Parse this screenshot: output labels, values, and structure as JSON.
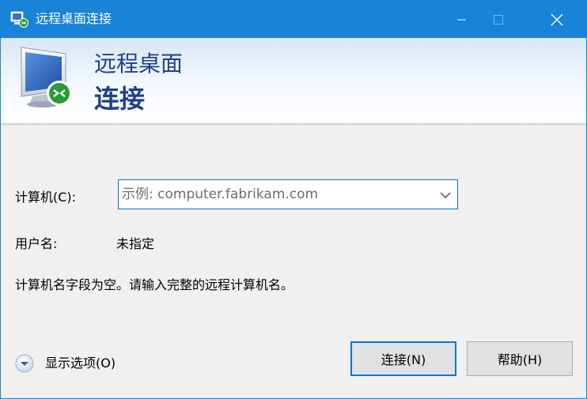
{
  "window": {
    "title": "远程桌面连接"
  },
  "banner": {
    "line1": "远程桌面",
    "line2": "连接"
  },
  "form": {
    "computer_label": "计算机(C):",
    "computer_value": "",
    "computer_placeholder": "示例: computer.fabrikam.com",
    "username_label": "用户名:",
    "username_value": "未指定",
    "message": "计算机名字段为空。请输入完整的远程计算机名。"
  },
  "footer": {
    "show_options_label": "显示选项(O)",
    "connect_label": "连接(N)",
    "help_label": "帮助(H)"
  },
  "colors": {
    "titlebar": "#1883d7",
    "banner_text": "#1f3f8f",
    "focus_border": "#0078d7"
  },
  "icons": {
    "app": "remote-desktop-icon",
    "banner": "monitor-connection-icon",
    "expand": "chevron-down-circle-icon",
    "dropdown": "chevron-down-icon"
  }
}
